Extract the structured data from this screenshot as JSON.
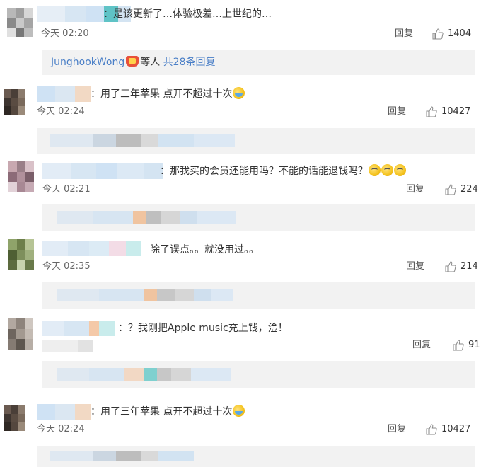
{
  "thumb_icon": "thumbs-up-icon",
  "reply_icon": "reply-text",
  "colors": {
    "link": "#4a7fc7",
    "sub_bg": "#f2f2f2",
    "text": "#333333",
    "meta": "#666666"
  },
  "comments": [
    {
      "text": "：是该更新了…体验极差…上世纪的…",
      "time": "今天 02:20",
      "reply": "回复",
      "likes": "1404",
      "sub": {
        "user": "JunghookWong",
        "mid": "等人",
        "count": "共28条回复"
      }
    },
    {
      "text": "：用了三年苹果 点开不超过十次",
      "time": "今天 02:24",
      "reply": "回复",
      "likes": "10427"
    },
    {
      "text": "：那我买的会员还能用吗？不能的话能退钱吗？",
      "time": "今天 02:21",
      "reply": "回复",
      "likes": "224"
    },
    {
      "text": "除了误点。。就没用过。。",
      "time": "今天 02:35",
      "reply": "回复",
      "likes": "214"
    },
    {
      "text": "：？我刚把Apple music充上钱，淦！",
      "time": "",
      "reply": "回复",
      "likes": "91"
    },
    {
      "text": "：用了三年苹果 点开不超过十次",
      "time": "今天 02:24",
      "reply": "回复",
      "likes": "10427"
    }
  ]
}
